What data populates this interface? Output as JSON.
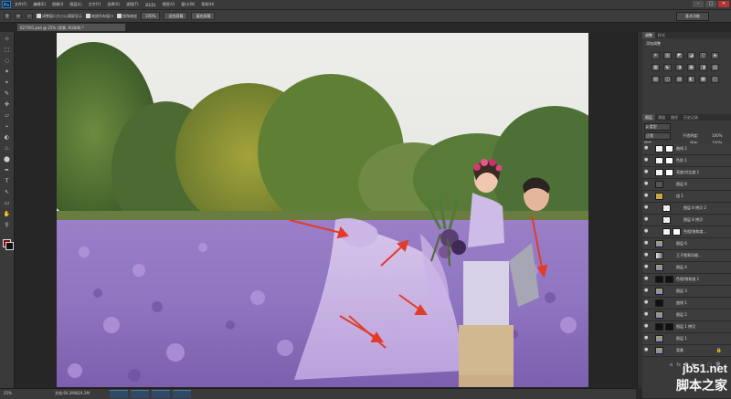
{
  "app": {
    "logo": "Ps"
  },
  "menu": [
    "文件(F)",
    "编辑(E)",
    "图像(I)",
    "图层(L)",
    "文字(Y)",
    "选择(S)",
    "滤镜(T)",
    "3D(D)",
    "视图(V)",
    "窗口(W)",
    "帮助(H)"
  ],
  "window_controls": [
    "–",
    "□",
    "✕"
  ],
  "options": {
    "resize_windows": "调整窗口大小以满屏显示",
    "zoom_all": "缩放所有窗口",
    "scrubby_zoom": "细微缩放",
    "btn_100": "100%",
    "btn_fit": "适合屏幕",
    "btn_fill": "填充屏幕",
    "workspace": "基本功能"
  },
  "document": {
    "tab": "627591.psd @ 25% (背景, RGB/8) *"
  },
  "tools": [
    "⊹",
    "⬚",
    "◌",
    "✶",
    "⌖",
    "✎",
    "✜",
    "▱",
    "⌁",
    "◐",
    "♨",
    "⬤",
    "✒",
    "T",
    "↖",
    "▭",
    "✋",
    "⚲"
  ],
  "status": {
    "zoom": "25%",
    "doc_size": "文档:60.2M/824.2M"
  },
  "panels": {
    "adjust_tabs": [
      "调整",
      "样式"
    ],
    "adjust_title": "添加调整",
    "adjust_icons": [
      "☀",
      "▥",
      "◩",
      "◪",
      "▽",
      "◈",
      "▦",
      "☯",
      "◑",
      "▣",
      "◨",
      "▤",
      "▧",
      "◫",
      "▨",
      "◧",
      "▩",
      "◰"
    ],
    "layer_tabs": [
      "图层",
      "通道",
      "路径",
      "历史记录"
    ],
    "kind": "ρ 类型",
    "blend": "正常",
    "opacity_label": "不透明度:",
    "opacity": "100%",
    "lock_label": "锁定:",
    "fill_label": "填充:",
    "fill": "100%"
  },
  "layers": [
    {
      "name": "曲线 2",
      "thumb": "white"
    },
    {
      "name": "色阶 1",
      "thumb": "white"
    },
    {
      "name": "亮度/对比度 1",
      "thumb": "white"
    },
    {
      "name": "图层 8",
      "thumb": "dark"
    },
    {
      "name": "组 1",
      "thumb": "group"
    },
    {
      "name": "图层 8 拷贝 2",
      "thumb": "checker"
    },
    {
      "name": "图层 8 拷贝",
      "thumb": "checker"
    },
    {
      "name": "色相/饱和度...",
      "thumb": "white"
    },
    {
      "name": "图层 6",
      "thumb": "photo"
    },
    {
      "name": "王子翡翠风格...",
      "thumb": "gradient"
    },
    {
      "name": "图层 4",
      "thumb": "photo"
    },
    {
      "name": "色相/饱和度 1",
      "thumb": "mask"
    },
    {
      "name": "图层 3",
      "thumb": "photo"
    },
    {
      "name": "曲线 1",
      "thumb": "black"
    },
    {
      "name": "图层 2",
      "thumb": "photo"
    },
    {
      "name": "图层 1 拷贝",
      "thumb": "mask"
    },
    {
      "name": "图层 1",
      "thumb": "photo"
    },
    {
      "name": "背景",
      "thumb": "photo",
      "locked": true
    }
  ],
  "panel_bottom": [
    "ɞ",
    "fx",
    "◘",
    "◐",
    "▭",
    "▢",
    "🗑"
  ],
  "watermark": {
    "line1": "jb51.net",
    "line2": "脚本之家"
  }
}
